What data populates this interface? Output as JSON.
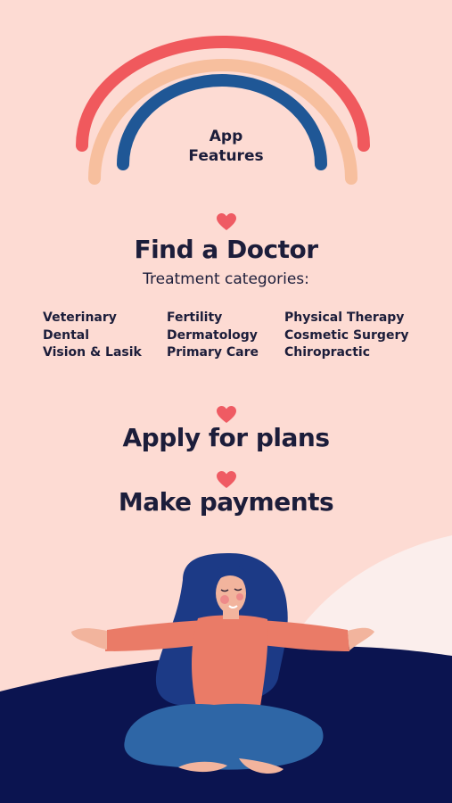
{
  "header": {
    "title_line1": "App",
    "title_line2": "Features"
  },
  "colors": {
    "background": "#fddbd3",
    "rainbow_outer": "#f0595d",
    "rainbow_middle": "#f7bf9e",
    "rainbow_inner": "#1f5796",
    "heart": "#ef5b63",
    "text": "#1c1d3a",
    "navy_ground": "#0b1450",
    "light_shape": "#fbeeec"
  },
  "sections": {
    "find_doctor": {
      "title": "Find a Doctor",
      "subtitle": "Treatment categories:",
      "categories": {
        "col1": [
          "Veterinary",
          "Dental",
          "Vision & Lasik"
        ],
        "col2": [
          "Fertility",
          "Dermatology",
          "Primary Care"
        ],
        "col3": [
          "Physical Therapy",
          "Cosmetic Surgery",
          "Chiropractic"
        ]
      }
    },
    "apply": {
      "title": "Apply for plans"
    },
    "payments": {
      "title": "Make payments"
    }
  },
  "icons": [
    "heart-icon",
    "rainbow-graphic",
    "woman-illustration"
  ]
}
